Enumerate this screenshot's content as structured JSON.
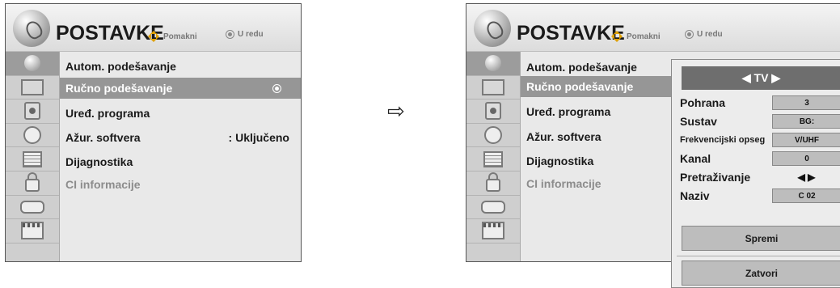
{
  "left": {
    "title": "POSTAVKE",
    "nav_move": "Pomakni",
    "nav_ok": "U redu",
    "icons": [
      "satellite-icon",
      "tv-icon",
      "speaker-icon",
      "clock-icon",
      "list-icon",
      "lock-icon",
      "plug-icon",
      "clapper-icon"
    ],
    "items": [
      {
        "label": "Autom. podešavanje",
        "value": ""
      },
      {
        "label": "Ručno podešavanje",
        "value": ""
      },
      {
        "label": "Uređ. programa",
        "value": ""
      },
      {
        "label": "Ažur. softvera",
        "value": ": Uključeno"
      },
      {
        "label": "Dijagnostika",
        "value": ""
      },
      {
        "label": "CI informacije",
        "value": ""
      }
    ]
  },
  "arrow": "⇨",
  "right": {
    "title": "POSTAVKE",
    "nav_move": "Pomakni",
    "nav_ok": "U redu",
    "items": [
      {
        "label": "Autom. podešavanje"
      },
      {
        "label": "Ručno podešavanje"
      },
      {
        "label": "Uređ. programa"
      },
      {
        "label": "Ažur. softvera"
      },
      {
        "label": "Dijagnostika"
      },
      {
        "label": "CI informacije"
      }
    ]
  },
  "submenu": {
    "header": "◀ TV ▶",
    "rows": [
      {
        "label": "Pohrana",
        "value": "3"
      },
      {
        "label": "Sustav",
        "value": "BG:"
      },
      {
        "label": "Frekvencijski opseg",
        "value": "V/UHF"
      },
      {
        "label": "Kanal",
        "value": "0"
      },
      {
        "label": "Pretraživanje",
        "value": "◀ ▶"
      },
      {
        "label": "Naziv",
        "value": "C 02"
      }
    ],
    "save": "Spremi",
    "close": "Zatvori"
  }
}
